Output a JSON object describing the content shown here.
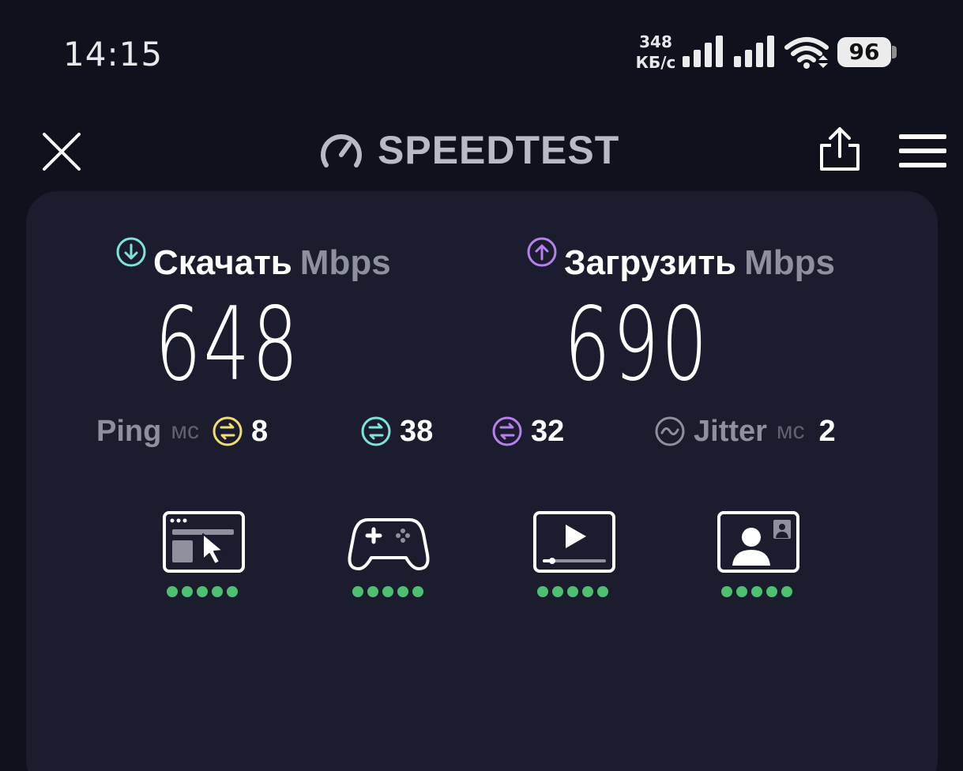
{
  "status_bar": {
    "time": "14:15",
    "net_speed_value": "348",
    "net_speed_unit": "КБ/с",
    "battery": "96"
  },
  "header": {
    "title": "SPEEDTEST",
    "close_icon": "close-icon",
    "share_icon": "share-icon",
    "menu_icon": "menu-icon",
    "logo_icon": "speedometer-icon"
  },
  "download": {
    "label": "Скачать",
    "unit": "Mbps",
    "value": "648",
    "color": "#7fe3dc"
  },
  "upload": {
    "label": "Загрузить",
    "unit": "Mbps",
    "value": "690",
    "color": "#b77ff0"
  },
  "ping": {
    "label": "Ping",
    "unit": "мс",
    "idle": "8",
    "download": "38",
    "upload": "32",
    "idle_color": "#f3dc74"
  },
  "jitter": {
    "label": "Jitter",
    "unit": "мс",
    "value": "2"
  },
  "use_cases": [
    {
      "icon": "web-browsing-icon",
      "rating": 5
    },
    {
      "icon": "gamepad-icon",
      "rating": 5
    },
    {
      "icon": "video-streaming-icon",
      "rating": 5
    },
    {
      "icon": "video-call-icon",
      "rating": 5
    }
  ],
  "colors": {
    "background": "#0f111d",
    "card": "#1b1d2e",
    "muted": "#8e909e",
    "rating_dot": "#4fbf72"
  }
}
